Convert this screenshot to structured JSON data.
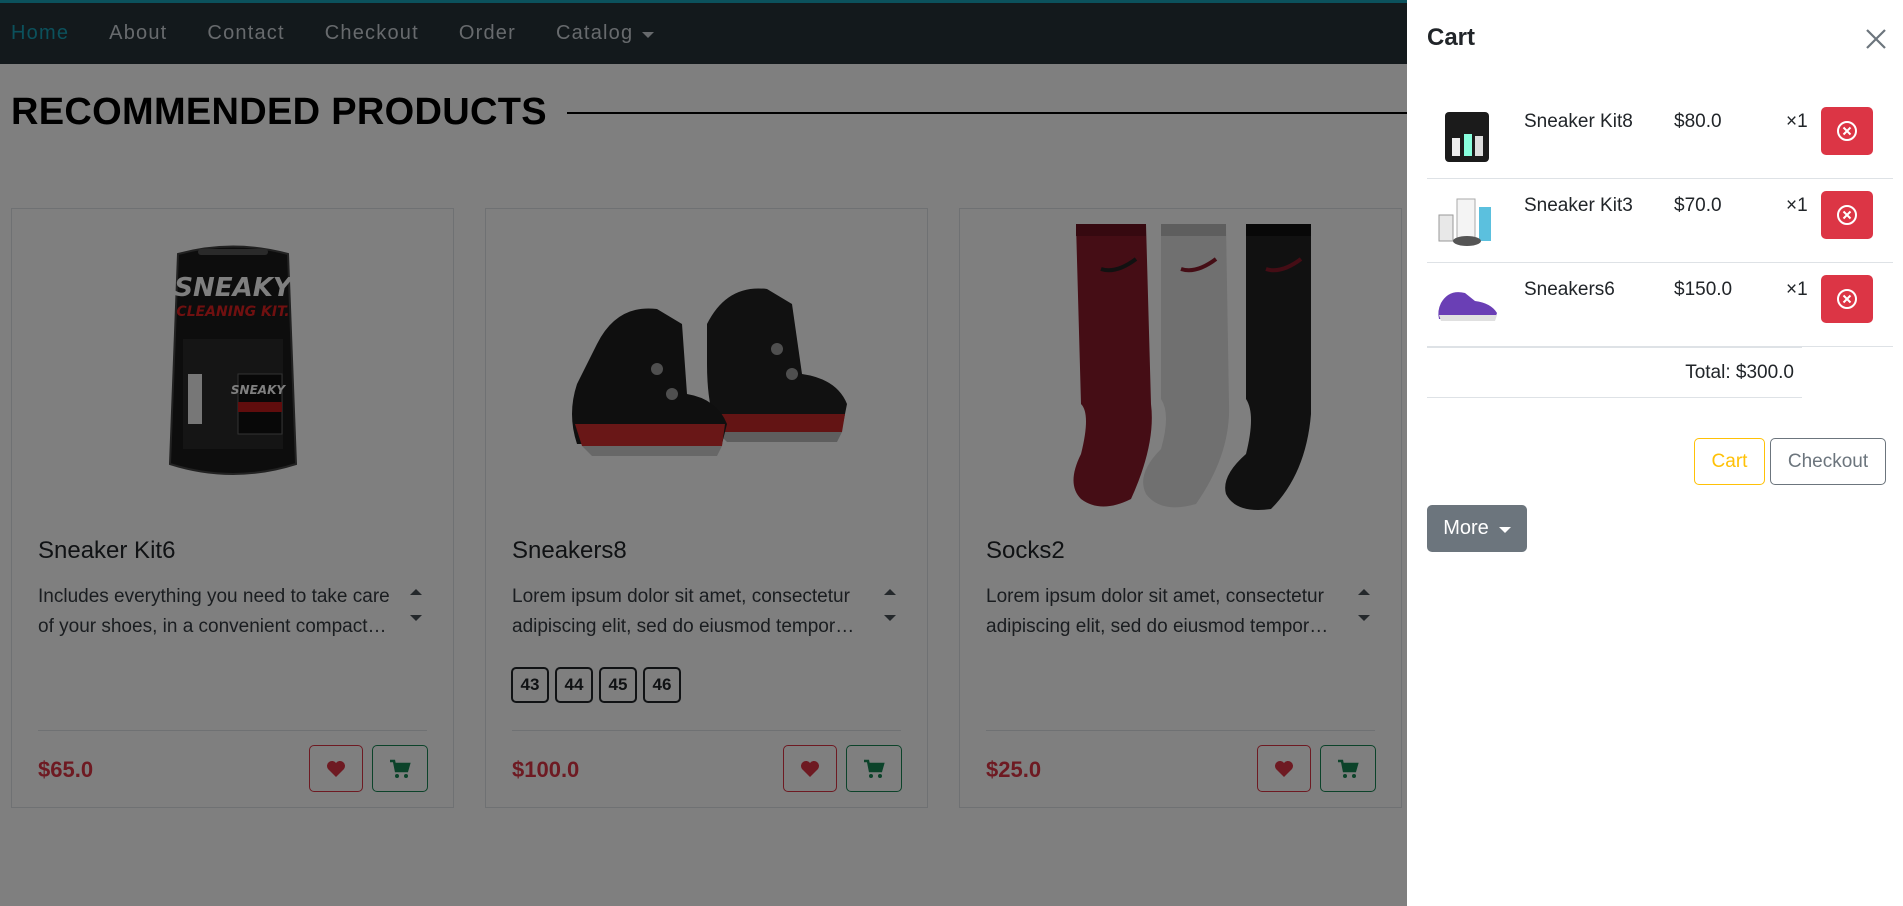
{
  "nav": {
    "items": [
      "Home",
      "About",
      "Contact",
      "Checkout",
      "Order"
    ],
    "dropdown_label": "Catalog",
    "active": "Home"
  },
  "main": {
    "heading": "RECOMMENDED PRODUCTS",
    "products": [
      {
        "name": "Sneaker Kit6",
        "description": "Includes everything you need to take care of your shoes, in a convenient compact package for home or travel.",
        "price": "$65.0",
        "sizes": [],
        "image": "cleaning-kit-icon"
      },
      {
        "name": "Sneakers8",
        "description": "Lorem ipsum dolor sit amet, consectetur adipiscing elit, sed do eiusmod tempor incididunt ut labore.",
        "price": "$100.0",
        "sizes": [
          "43",
          "44",
          "45",
          "46"
        ],
        "image": "sneaker-icon"
      },
      {
        "name": "Socks2",
        "description": "Lorem ipsum dolor sit amet, consectetur adipiscing elit, sed do eiusmod tempor incididunt ut labore.",
        "price": "$25.0",
        "sizes": [],
        "image": "socks-icon"
      }
    ]
  },
  "cart": {
    "title": "Cart",
    "items": [
      {
        "name": "Sneaker Kit8",
        "price": "$80.0",
        "qty": "×1"
      },
      {
        "name": "Sneaker Kit3",
        "price": "$70.0",
        "qty": "×1"
      },
      {
        "name": "Sneakers6",
        "price": "$150.0",
        "qty": "×1"
      }
    ],
    "total": "Total: $300.0",
    "cart_button": "Cart",
    "checkout_button": "Checkout",
    "more_button": "More"
  },
  "colors": {
    "navbar": "#263238",
    "accent": "#17a2b8",
    "danger": "#dc3545",
    "success": "#198754",
    "warning": "#ffc107",
    "secondary": "#6c757d"
  }
}
